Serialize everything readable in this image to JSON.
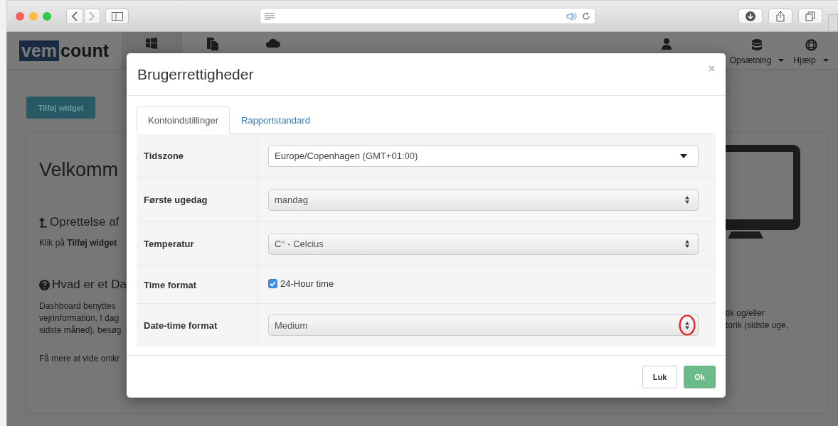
{
  "navbar": {
    "logo": {
      "boxed": "vem",
      "rest": "count"
    },
    "tabs": [
      {
        "selected": true
      },
      {
        "selected": false
      },
      {
        "selected": false
      }
    ],
    "menus": [
      {
        "label": "Opsætning"
      },
      {
        "label": "Hjælp"
      }
    ]
  },
  "page": {
    "add_button": "Tilføj widget",
    "left_texts": [
      {
        "kind": "title",
        "text": "Velkomm"
      },
      {
        "kind": "heading",
        "text": "Oprettelse af"
      },
      {
        "kind": "para",
        "text": "Klik på **Tilføj widget**"
      },
      {
        "kind": "heading",
        "text": "Hvad er et Da"
      },
      {
        "kind": "lines",
        "lines": [
          "Dashboard benyttes",
          "vejrinformation. I dag",
          "sidste måned), besøg"
        ]
      },
      {
        "kind": "para",
        "text": "Få mere at vide omkr"
      }
    ],
    "right_lines": [
      "tik og/eller",
      "torik (sidste uge,"
    ]
  },
  "modal": {
    "title": "Brugerrettigheder",
    "tabs": [
      {
        "label": "Kontoindstillinger",
        "selected": true
      },
      {
        "label": "Rapportstandard",
        "selected": false
      }
    ],
    "rows": [
      {
        "label": "Tidszone",
        "kind": "dropdown",
        "value": "Europe/Copenhagen (GMT+01:00)"
      },
      {
        "label": "Første ugedag",
        "kind": "stepper",
        "value": "mandag"
      },
      {
        "label": "Temperatur",
        "kind": "stepper",
        "value": "C° - Celcius"
      },
      {
        "label": "Time format",
        "kind": "checkbox",
        "value": "24-Hour time",
        "checked": true
      },
      {
        "label": "Date-time format",
        "kind": "stepper",
        "value": "Medium",
        "highlighted": true
      }
    ],
    "buttons": [
      {
        "label": "Luk",
        "kind": "default"
      },
      {
        "label": "Ok",
        "kind": "primary"
      }
    ]
  }
}
